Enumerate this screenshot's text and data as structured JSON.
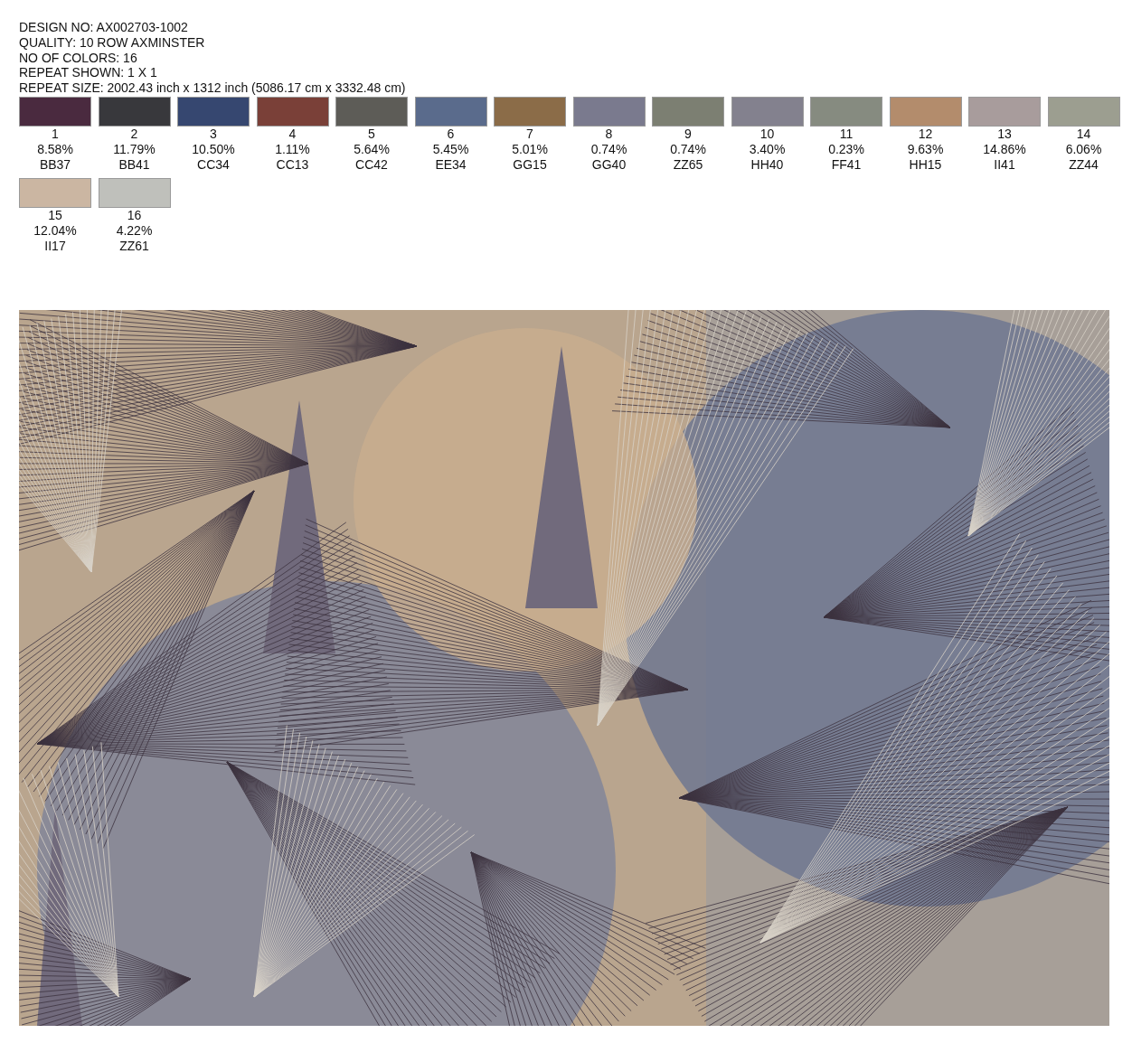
{
  "header_lines": [
    "DESIGN NO: AX002703-1002",
    "QUALITY: 10 ROW AXMINSTER",
    "NO OF COLORS: 16",
    "REPEAT SHOWN: 1 X 1",
    "REPEAT SIZE: 2002.43 inch x 1312 inch (5086.17 cm x 3332.48 cm)"
  ],
  "colors": [
    {
      "number": "1",
      "percent": "8.58%",
      "code": "BB37",
      "color": "#4a2a3f"
    },
    {
      "number": "2",
      "percent": "11.79%",
      "code": "BB41",
      "color": "#38383c"
    },
    {
      "number": "3",
      "percent": "10.50%",
      "code": "CC34",
      "color": "#364770"
    },
    {
      "number": "4",
      "percent": "1.11%",
      "code": "CC13",
      "color": "#7a4038"
    },
    {
      "number": "5",
      "percent": "5.64%",
      "code": "CC42",
      "color": "#5d5c57"
    },
    {
      "number": "6",
      "percent": "5.45%",
      "code": "EE34",
      "color": "#5a6b8c"
    },
    {
      "number": "7",
      "percent": "5.01%",
      "code": "GG15",
      "color": "#8b6c48"
    },
    {
      "number": "8",
      "percent": "0.74%",
      "code": "GG40",
      "color": "#7a7a8e"
    },
    {
      "number": "9",
      "percent": "0.74%",
      "code": "ZZ65",
      "color": "#7c7f72"
    },
    {
      "number": "10",
      "percent": "3.40%",
      "code": "HH40",
      "color": "#83818e"
    },
    {
      "number": "11",
      "percent": "0.23%",
      "code": "FF41",
      "color": "#868b80"
    },
    {
      "number": "12",
      "percent": "9.63%",
      "code": "HH15",
      "color": "#b38c6c"
    },
    {
      "number": "13",
      "percent": "14.86%",
      "code": "II41",
      "color": "#a89c9c"
    },
    {
      "number": "14",
      "percent": "6.06%",
      "code": "ZZ44",
      "color": "#9c9e90"
    },
    {
      "number": "15",
      "percent": "12.04%",
      "code": "II17",
      "color": "#cbb6a2"
    },
    {
      "number": "16",
      "percent": "4.22%",
      "code": "ZZ61",
      "color": "#bfc0bb"
    }
  ]
}
